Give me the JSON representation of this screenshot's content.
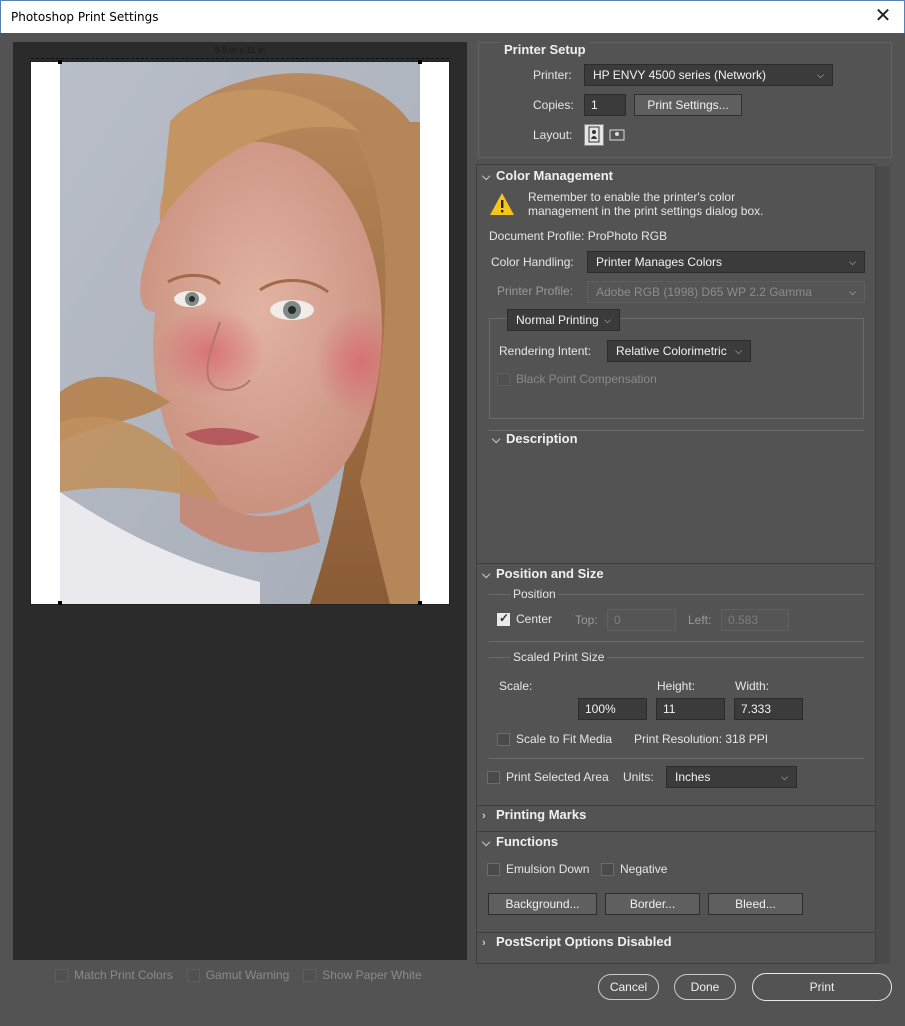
{
  "window": {
    "title": "Photoshop Print Settings",
    "close_glyph": "✕"
  },
  "preview": {
    "paper_size": "8.5 in x 11 in",
    "checks": [
      {
        "label": "Match Print Colors"
      },
      {
        "label": "Gamut Warning"
      },
      {
        "label": "Show Paper White"
      }
    ]
  },
  "printer_setup": {
    "title": "Printer Setup",
    "printer_label": "Printer:",
    "printer_value": "HP ENVY 4500 series (Network)",
    "copies_label": "Copies:",
    "copies_value": "1",
    "print_settings_button": "Print Settings...",
    "layout_label": "Layout:"
  },
  "color_management": {
    "title": "Color Management",
    "warning_line1": "Remember to enable the printer's color",
    "warning_line2": "management in the print settings dialog box.",
    "doc_profile": "Document Profile: ProPhoto RGB",
    "handling_label": "Color Handling:",
    "handling_value": "Printer Manages Colors",
    "profile_label": "Printer Profile:",
    "profile_value": "Adobe RGB (1998) D65 WP 2.2 Gamma",
    "mode_value": "Normal Printing",
    "intent_label": "Rendering Intent:",
    "intent_value": "Relative Colorimetric",
    "bpc_label": "Black Point Compensation",
    "description_title": "Description"
  },
  "position_size": {
    "title": "Position and Size",
    "position_group": "Position",
    "center_label": "Center",
    "top_label": "Top:",
    "top_value": "0",
    "left_label": "Left:",
    "left_value": "0.583",
    "scaled_group": "Scaled Print Size",
    "scale_label": "Scale:",
    "scale_value": "100%",
    "height_label": "Height:",
    "height_value": "11",
    "width_label": "Width:",
    "width_value": "7.333",
    "fit_label": "Scale to Fit Media",
    "resolution": "Print Resolution: 318 PPI",
    "print_selected_label": "Print Selected Area",
    "units_label": "Units:",
    "units_value": "Inches"
  },
  "printing_marks": {
    "title": "Printing Marks"
  },
  "functions": {
    "title": "Functions",
    "emulsion_label": "Emulsion Down",
    "negative_label": "Negative",
    "background_button": "Background...",
    "border_button": "Border...",
    "bleed_button": "Bleed..."
  },
  "postscript": {
    "title": "PostScript Options Disabled"
  },
  "footer": {
    "cancel": "Cancel",
    "done": "Done",
    "print": "Print"
  }
}
